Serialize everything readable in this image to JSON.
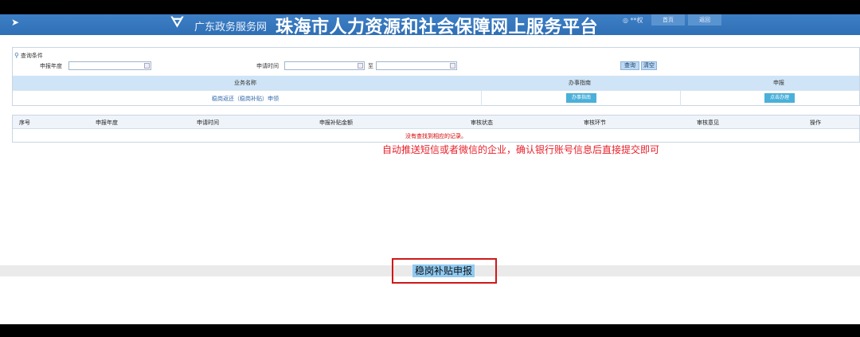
{
  "header": {
    "logo_glyph": "ᗊ",
    "portal": "广东政务服务网",
    "title": "珠海市人力资源和社会保障网上服务平台",
    "user": "◎ **权",
    "home_label": "首页",
    "back_label": "返回"
  },
  "query": {
    "label": "查询条件",
    "year_label": "申报年度",
    "year_value": "",
    "apply_time_label": "申请时间",
    "apply_time_from": "",
    "to_label": "至",
    "apply_time_to": "",
    "search_label": "查询",
    "clear_label": "清空"
  },
  "services": {
    "columns": [
      "业务名称",
      "办事指南",
      "申报"
    ],
    "rows": [
      {
        "name": "稳岗返还（稳岗补贴）申领",
        "guide_label": "办事指南",
        "apply_label": "点击办理"
      }
    ]
  },
  "records": {
    "columns": [
      "序号",
      "申报年度",
      "申请时间",
      "申报补贴金额",
      "审核状态",
      "审核环节",
      "审核意见",
      "操作"
    ],
    "empty_message": "没有查找到相应的记录。"
  },
  "annotation": "自动推送短信或者微信的企业，确认银行账号信息后直接提交即可",
  "footer": {
    "subsidy_label": "稳岗补贴申报"
  },
  "colors": {
    "header_bg": "#2f6fb5",
    "table_head_bg": "#cfe4f6",
    "button_bg": "#4ab0d9",
    "annotation": "#e8202a",
    "highlight_box": "#d01818"
  }
}
